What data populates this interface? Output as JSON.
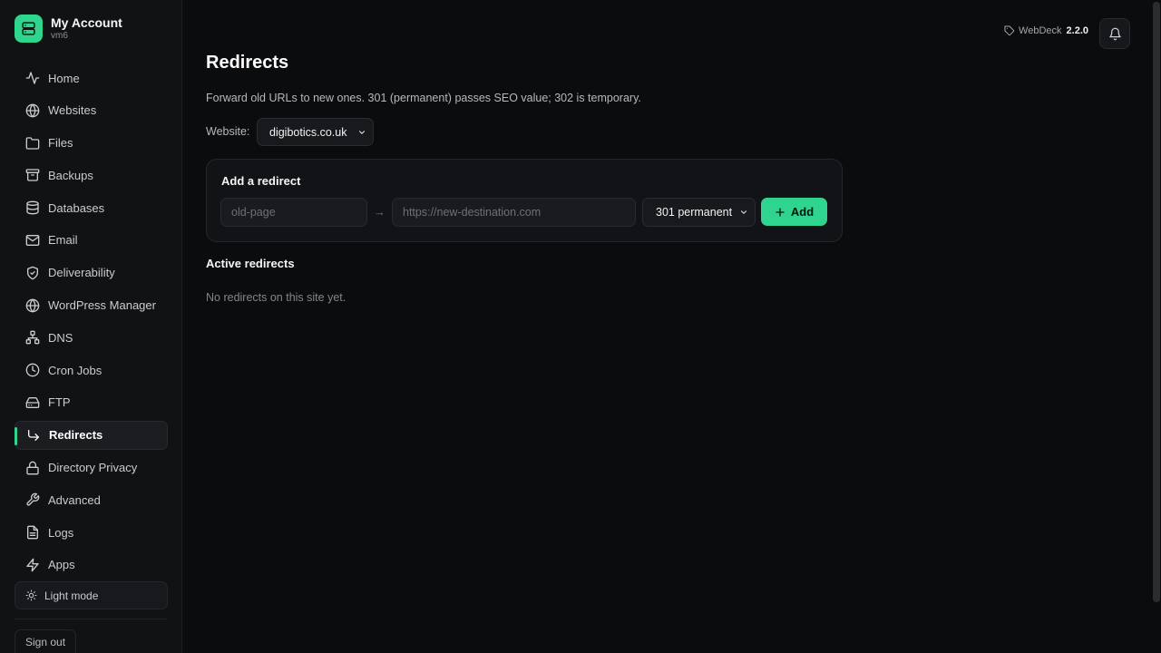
{
  "brand": {
    "title": "My Account",
    "subtitle": "vm6"
  },
  "sidebar": {
    "items": [
      {
        "label": "Home",
        "icon": "activity-icon"
      },
      {
        "label": "Websites",
        "icon": "globe-icon"
      },
      {
        "label": "Files",
        "icon": "folder-icon"
      },
      {
        "label": "Backups",
        "icon": "archive-icon"
      },
      {
        "label": "Databases",
        "icon": "database-icon"
      },
      {
        "label": "Email",
        "icon": "mail-icon"
      },
      {
        "label": "Deliverability",
        "icon": "shield-icon"
      },
      {
        "label": "WordPress Manager",
        "icon": "globe-icon"
      },
      {
        "label": "DNS",
        "icon": "network-icon"
      },
      {
        "label": "Cron Jobs",
        "icon": "clock-icon"
      },
      {
        "label": "FTP",
        "icon": "drive-icon"
      },
      {
        "label": "Redirects",
        "icon": "redirect-arrow-icon",
        "active": true
      },
      {
        "label": "Directory Privacy",
        "icon": "lock-icon"
      },
      {
        "label": "Advanced",
        "icon": "wrench-icon"
      },
      {
        "label": "Logs",
        "icon": "file-text-icon"
      },
      {
        "label": "Apps",
        "icon": "lightning-icon"
      }
    ],
    "light_mode_label": "Light mode",
    "sign_out_label": "Sign out"
  },
  "header": {
    "product": "WebDeck",
    "version": "2.2.0"
  },
  "main": {
    "title": "Redirects",
    "description": "Forward old URLs to new ones. 301 (permanent) passes SEO value; 302 is temporary.",
    "website_label": "Website:",
    "website_selected": "digibotics.co.uk",
    "add_card": {
      "title": "Add a redirect",
      "source_placeholder": "old-page",
      "arrow": "→",
      "destination_placeholder": "https://new-destination.com",
      "type_selected": "301 permanent",
      "add_label": "Add"
    },
    "active_title": "Active redirects",
    "empty_message": "No redirects on this site yet."
  },
  "colors": {
    "accent": "#2fd58f",
    "background": "#0b0c0e",
    "sidebar": "#111214"
  }
}
